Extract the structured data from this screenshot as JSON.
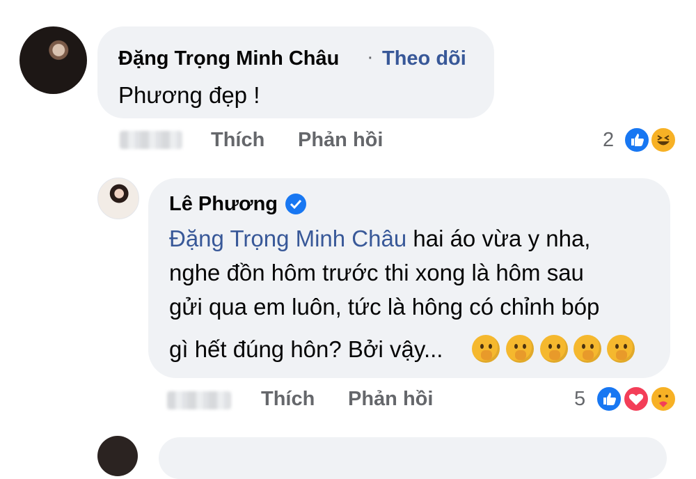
{
  "comment": {
    "author": "Đặng Trọng Minh Châu",
    "separator": "·",
    "follow_label": "Theo dõi",
    "text": "Phương đẹp !",
    "like_label": "Thích",
    "reply_label": "Phản hồi",
    "reaction_count": "2",
    "reactions": [
      "like",
      "haha"
    ]
  },
  "reply": {
    "author": "Lê Phương",
    "verified": true,
    "mention": "Đặng Trọng Minh Châu",
    "line1_rest": " hai áo vừa y nha,",
    "line2": "nghe đồn hôm trước thi xong là hôm sau",
    "line3": "gửi qua em luôn, tức là hông có chỉnh bóp",
    "line4": "gì hết đúng hôn? Bởi vậy...",
    "emoji_count": 5,
    "emoji_icon": "face-with-hand-over-mouth",
    "like_label": "Thích",
    "reply_label": "Phản hồi",
    "reaction_count": "5",
    "reactions": [
      "like",
      "love",
      "care"
    ]
  },
  "colors": {
    "bubble": "#f0f2f5",
    "link": "#385898",
    "meta": "#65676b",
    "like": "#1877f2",
    "love": "#f33e58",
    "haha": "#f7b125"
  }
}
